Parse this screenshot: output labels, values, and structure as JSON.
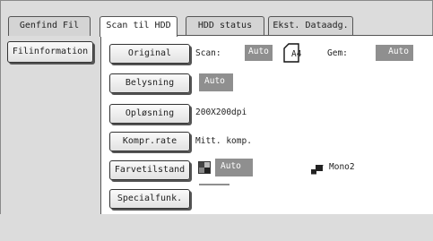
{
  "tabs": [
    {
      "label": "Genfind Fil",
      "active": false
    },
    {
      "label": "Scan til HDD",
      "active": true
    },
    {
      "label": "HDD status",
      "active": false
    },
    {
      "label": "Ekst. Dataadg.",
      "active": false
    }
  ],
  "side_button": "Filinformation",
  "rows": {
    "original": {
      "button": "Original",
      "scan_label": "Scan:",
      "scan_value": "Auto",
      "paper_size": "A4",
      "gem_label": "Gem:",
      "gem_value": "Auto"
    },
    "belysning": {
      "button": "Belysning",
      "value": "Auto"
    },
    "oplosning": {
      "button": "Opløsning",
      "value": "200X200dpi"
    },
    "kompr": {
      "button": "Kompr.rate",
      "value": "Mitt. komp."
    },
    "farve": {
      "button": "Farvetilstand",
      "value": "Auto",
      "mono_value": "Mono2"
    },
    "special": {
      "button": "Specialfunk."
    }
  },
  "colors": {
    "value_bg": "#8f8f8f",
    "frame_bg": "#dcdcdc"
  }
}
